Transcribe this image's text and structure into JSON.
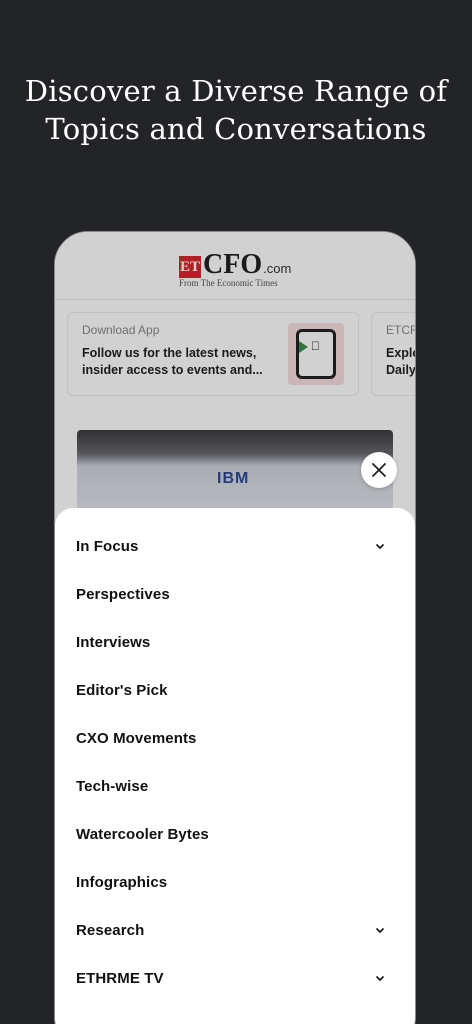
{
  "headline": {
    "line1": "Discover a Diverse Range of",
    "line2": "Topics and Conversations"
  },
  "app": {
    "logo": {
      "et": "ET",
      "cfo": "CFO",
      "com": ".com",
      "subtitle": "From The Economic Times"
    },
    "promo_cards": [
      {
        "eyebrow": "Download App",
        "text": "Follow us for the latest news, insider access to events and..."
      },
      {
        "eyebrow": "ETCF",
        "text": "Explo Daily"
      }
    ],
    "hero_logo": "IBM"
  },
  "menu": {
    "items": [
      {
        "label": "In Focus",
        "expandable": true
      },
      {
        "label": "Perspectives",
        "expandable": false
      },
      {
        "label": "Interviews",
        "expandable": false
      },
      {
        "label": "Editor's Pick",
        "expandable": false
      },
      {
        "label": "CXO Movements",
        "expandable": false
      },
      {
        "label": "Tech-wise",
        "expandable": false
      },
      {
        "label": "Watercooler Bytes",
        "expandable": false
      },
      {
        "label": "Infographics",
        "expandable": false
      },
      {
        "label": "Research",
        "expandable": true
      },
      {
        "label": "ETHRME TV",
        "expandable": true
      }
    ]
  },
  "colors": {
    "background": "#232427",
    "brand_red": "#d9262d",
    "sheet": "#ffffff"
  },
  "icons": {
    "close": "close-icon",
    "expand": "chevron-down-icon"
  }
}
